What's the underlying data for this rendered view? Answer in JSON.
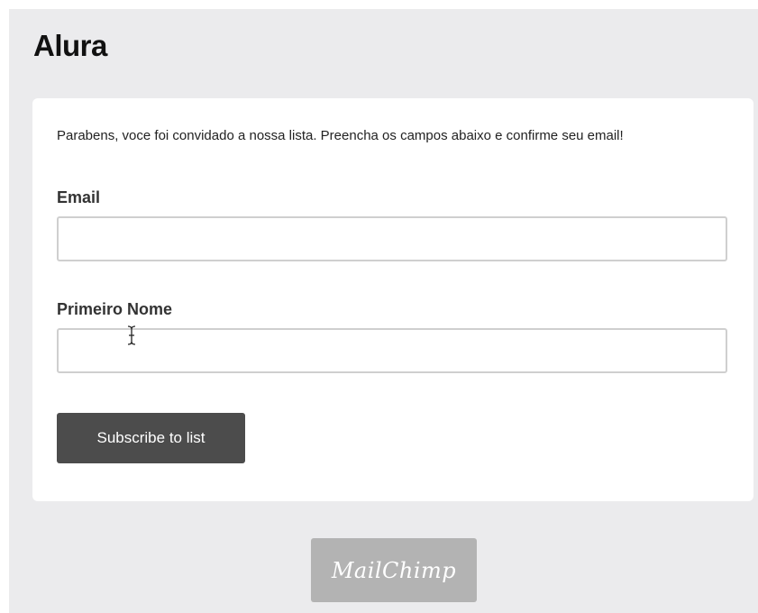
{
  "header": {
    "title": "Alura"
  },
  "form": {
    "intro_text": "Parabens, voce foi convidado a nossa lista. Preencha os campos abaixo e confirme seu email!",
    "email": {
      "label": "Email",
      "value": "",
      "placeholder": ""
    },
    "first_name": {
      "label": "Primeiro Nome",
      "value": "",
      "placeholder": ""
    },
    "submit_label": "Subscribe to list"
  },
  "footer": {
    "badge_text": "MailChimp",
    "badge_color": "#b3b3b3"
  },
  "colors": {
    "page_background": "#ebebed",
    "card_background": "#ffffff",
    "button_background": "#4c4c4c"
  },
  "icons": {
    "cursor": "text-cursor-icon"
  }
}
